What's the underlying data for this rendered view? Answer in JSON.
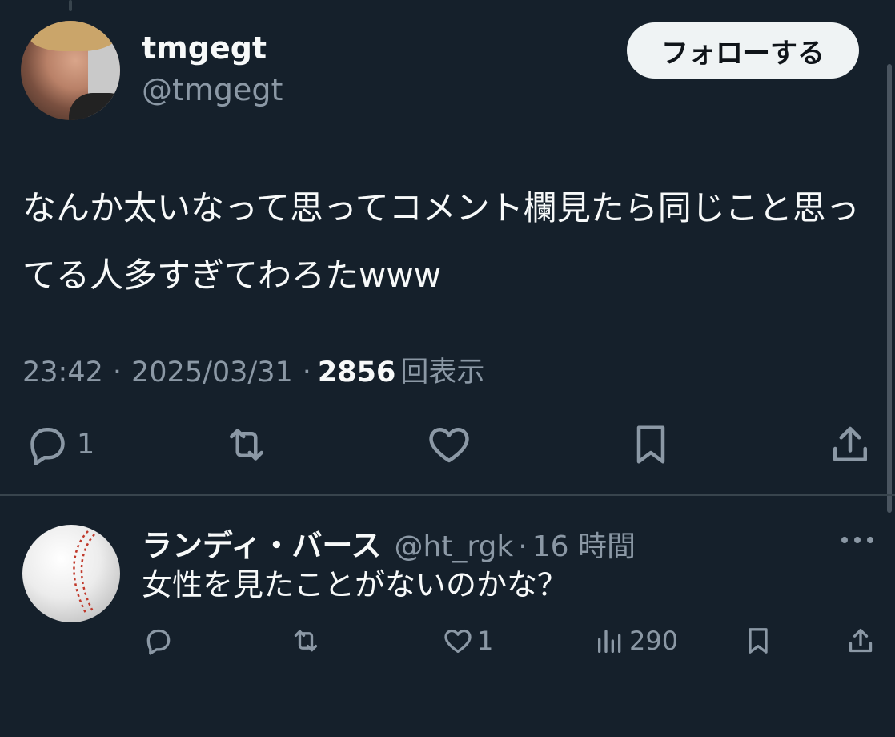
{
  "tweet": {
    "display_name": "tmgegt",
    "handle": "@tmgegt",
    "follow_label": "フォローする",
    "text": "なんか太いなって思ってコメント欄見たら同じこと思ってる人多すぎてわろたwww",
    "time": "23:42",
    "date": "2025/03/31",
    "separator": "·",
    "views": "2856",
    "views_label": "回表示",
    "reply_count": "1"
  },
  "reply": {
    "display_name": "ランディ・バース",
    "handle": "@ht_rgk",
    "separator": "·",
    "time": "16 時間",
    "text": "女性を見たことがないのかな？",
    "like_count": "1",
    "views": "290"
  },
  "colors": {
    "background": "#15202b",
    "text_primary": "#f7f9f9",
    "text_secondary": "#8b98a5",
    "divider": "#38444d",
    "button_bg": "#eff3f4"
  },
  "icons": {
    "reply": "reply-icon",
    "retweet": "retweet-icon",
    "like": "heart-icon",
    "bookmark": "bookmark-icon",
    "share": "share-icon",
    "views": "analytics-icon",
    "more": "more-icon"
  }
}
